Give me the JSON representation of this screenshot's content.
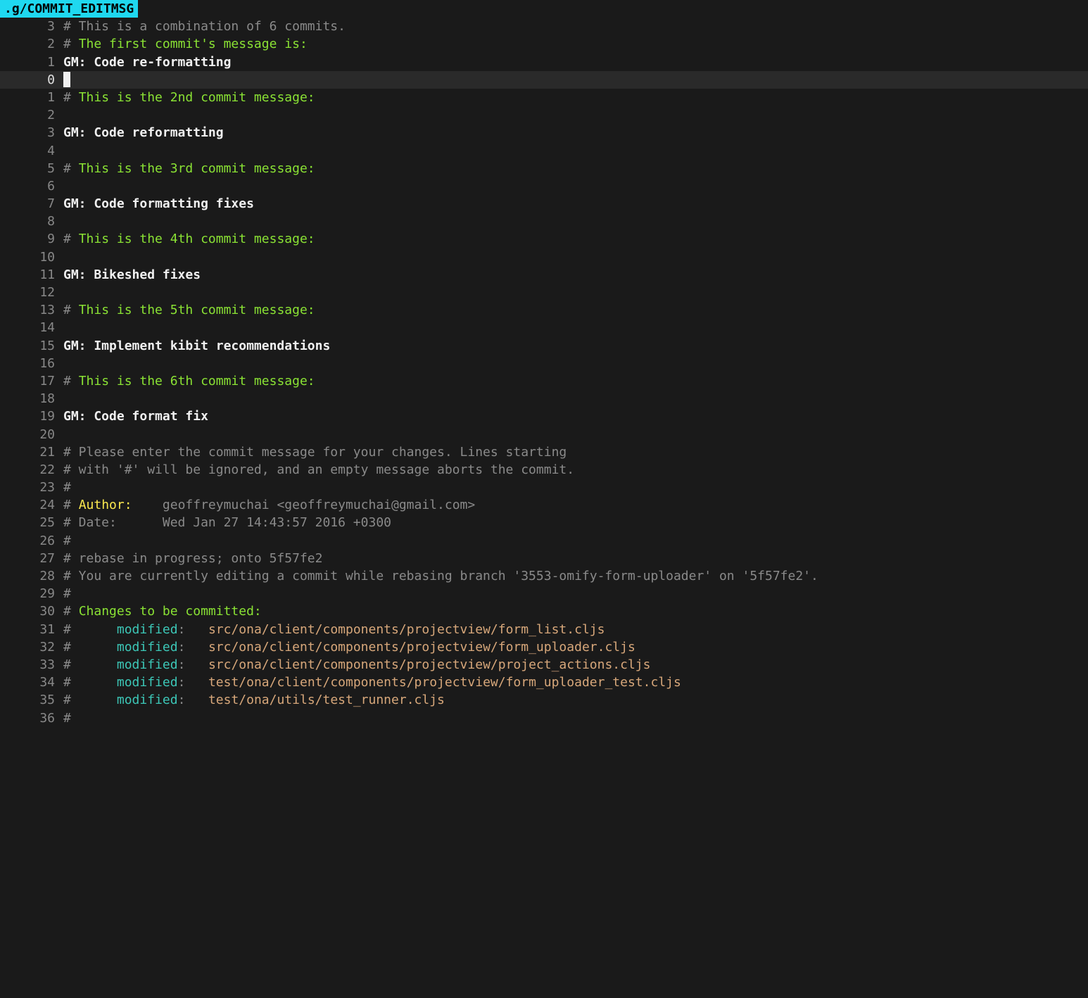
{
  "filename": ".g/COMMIT_EDITMSG",
  "colors": {
    "tab_bg": "#1fd8f0",
    "bg": "#1a1a1a",
    "current_line_bg": "#2a2a2a",
    "comment": "#8a8a8a",
    "green": "#8ae234",
    "yellow": "#fce94f",
    "white": "#f0f0f0",
    "cyan": "#3cc7b7",
    "tan": "#d7a77a"
  },
  "cursor_line_index": 3,
  "lines": [
    {
      "num": "3",
      "spans": [
        {
          "t": "# This is a combination of 6 commits.",
          "cls": "c-comment"
        }
      ]
    },
    {
      "num": "2",
      "spans": [
        {
          "t": "# ",
          "cls": "c-comment"
        },
        {
          "t": "The first commit's message is:",
          "cls": "c-green"
        }
      ]
    },
    {
      "num": "1",
      "spans": [
        {
          "t": "GM: Code re-formatting",
          "cls": "c-white c-bold"
        }
      ]
    },
    {
      "num": "0",
      "current": true,
      "cursor": true,
      "spans": []
    },
    {
      "num": "1",
      "spans": [
        {
          "t": "# ",
          "cls": "c-comment"
        },
        {
          "t": "This is the 2nd commit message:",
          "cls": "c-green"
        }
      ]
    },
    {
      "num": "2",
      "spans": []
    },
    {
      "num": "3",
      "spans": [
        {
          "t": "GM: Code reformatting",
          "cls": "c-white c-bold"
        }
      ]
    },
    {
      "num": "4",
      "spans": []
    },
    {
      "num": "5",
      "spans": [
        {
          "t": "# ",
          "cls": "c-comment"
        },
        {
          "t": "This is the 3rd commit message:",
          "cls": "c-green"
        }
      ]
    },
    {
      "num": "6",
      "spans": []
    },
    {
      "num": "7",
      "spans": [
        {
          "t": "GM: Code formatting fixes",
          "cls": "c-white c-bold"
        }
      ]
    },
    {
      "num": "8",
      "spans": []
    },
    {
      "num": "9",
      "spans": [
        {
          "t": "# ",
          "cls": "c-comment"
        },
        {
          "t": "This is the 4th commit message:",
          "cls": "c-green"
        }
      ]
    },
    {
      "num": "10",
      "spans": []
    },
    {
      "num": "11",
      "spans": [
        {
          "t": "GM: Bikeshed fixes",
          "cls": "c-white c-bold"
        }
      ]
    },
    {
      "num": "12",
      "spans": []
    },
    {
      "num": "13",
      "spans": [
        {
          "t": "# ",
          "cls": "c-comment"
        },
        {
          "t": "This is the 5th commit message:",
          "cls": "c-green"
        }
      ]
    },
    {
      "num": "14",
      "spans": []
    },
    {
      "num": "15",
      "spans": [
        {
          "t": "GM: Implement kibit recommendations",
          "cls": "c-white c-bold"
        }
      ]
    },
    {
      "num": "16",
      "spans": []
    },
    {
      "num": "17",
      "spans": [
        {
          "t": "# ",
          "cls": "c-comment"
        },
        {
          "t": "This is the 6th commit message:",
          "cls": "c-green"
        }
      ]
    },
    {
      "num": "18",
      "spans": []
    },
    {
      "num": "19",
      "spans": [
        {
          "t": "GM: Code format fix",
          "cls": "c-white c-bold"
        }
      ]
    },
    {
      "num": "20",
      "spans": []
    },
    {
      "num": "21",
      "spans": [
        {
          "t": "# Please enter the commit message for your changes. Lines starting",
          "cls": "c-comment"
        }
      ]
    },
    {
      "num": "22",
      "spans": [
        {
          "t": "# with '#' will be ignored, and an empty message aborts the commit.",
          "cls": "c-comment"
        }
      ]
    },
    {
      "num": "23",
      "spans": [
        {
          "t": "#",
          "cls": "c-comment"
        }
      ]
    },
    {
      "num": "24",
      "spans": [
        {
          "t": "# ",
          "cls": "c-comment"
        },
        {
          "t": "Author:",
          "cls": "c-yellow"
        },
        {
          "t": "    geoffreymuchai <geoffreymuchai@gmail.com>",
          "cls": "c-comment"
        }
      ]
    },
    {
      "num": "25",
      "spans": [
        {
          "t": "# Date:      Wed Jan 27 14:43:57 2016 +0300",
          "cls": "c-comment"
        }
      ]
    },
    {
      "num": "26",
      "spans": [
        {
          "t": "#",
          "cls": "c-comment"
        }
      ]
    },
    {
      "num": "27",
      "spans": [
        {
          "t": "# rebase in progress; onto 5f57fe2",
          "cls": "c-comment"
        }
      ]
    },
    {
      "num": "28",
      "spans": [
        {
          "t": "# You are currently editing a commit while rebasing branch '3553-omify-form-uploader' on '5f57fe2'.",
          "cls": "c-comment"
        }
      ]
    },
    {
      "num": "29",
      "spans": [
        {
          "t": "#",
          "cls": "c-comment"
        }
      ]
    },
    {
      "num": "30",
      "spans": [
        {
          "t": "# ",
          "cls": "c-comment"
        },
        {
          "t": "Changes to be committed:",
          "cls": "c-green"
        }
      ]
    },
    {
      "num": "31",
      "spans": [
        {
          "t": "#",
          "cls": "c-comment"
        },
        {
          "t": "      ",
          "cls": ""
        },
        {
          "t": "modified",
          "cls": "c-cyan"
        },
        {
          "t": ":   ",
          "cls": "c-comment"
        },
        {
          "t": "src/ona/client/components/projectview/form_list.cljs",
          "cls": "c-tan"
        }
      ]
    },
    {
      "num": "32",
      "spans": [
        {
          "t": "#",
          "cls": "c-comment"
        },
        {
          "t": "      ",
          "cls": ""
        },
        {
          "t": "modified",
          "cls": "c-cyan"
        },
        {
          "t": ":   ",
          "cls": "c-comment"
        },
        {
          "t": "src/ona/client/components/projectview/form_uploader.cljs",
          "cls": "c-tan"
        }
      ]
    },
    {
      "num": "33",
      "spans": [
        {
          "t": "#",
          "cls": "c-comment"
        },
        {
          "t": "      ",
          "cls": ""
        },
        {
          "t": "modified",
          "cls": "c-cyan"
        },
        {
          "t": ":   ",
          "cls": "c-comment"
        },
        {
          "t": "src/ona/client/components/projectview/project_actions.cljs",
          "cls": "c-tan"
        }
      ]
    },
    {
      "num": "34",
      "spans": [
        {
          "t": "#",
          "cls": "c-comment"
        },
        {
          "t": "      ",
          "cls": ""
        },
        {
          "t": "modified",
          "cls": "c-cyan"
        },
        {
          "t": ":   ",
          "cls": "c-comment"
        },
        {
          "t": "test/ona/client/components/projectview/form_uploader_test.cljs",
          "cls": "c-tan"
        }
      ]
    },
    {
      "num": "35",
      "spans": [
        {
          "t": "#",
          "cls": "c-comment"
        },
        {
          "t": "      ",
          "cls": ""
        },
        {
          "t": "modified",
          "cls": "c-cyan"
        },
        {
          "t": ":   ",
          "cls": "c-comment"
        },
        {
          "t": "test/ona/utils/test_runner.cljs",
          "cls": "c-tan"
        }
      ]
    },
    {
      "num": "36",
      "spans": [
        {
          "t": "#",
          "cls": "c-comment"
        }
      ]
    }
  ]
}
